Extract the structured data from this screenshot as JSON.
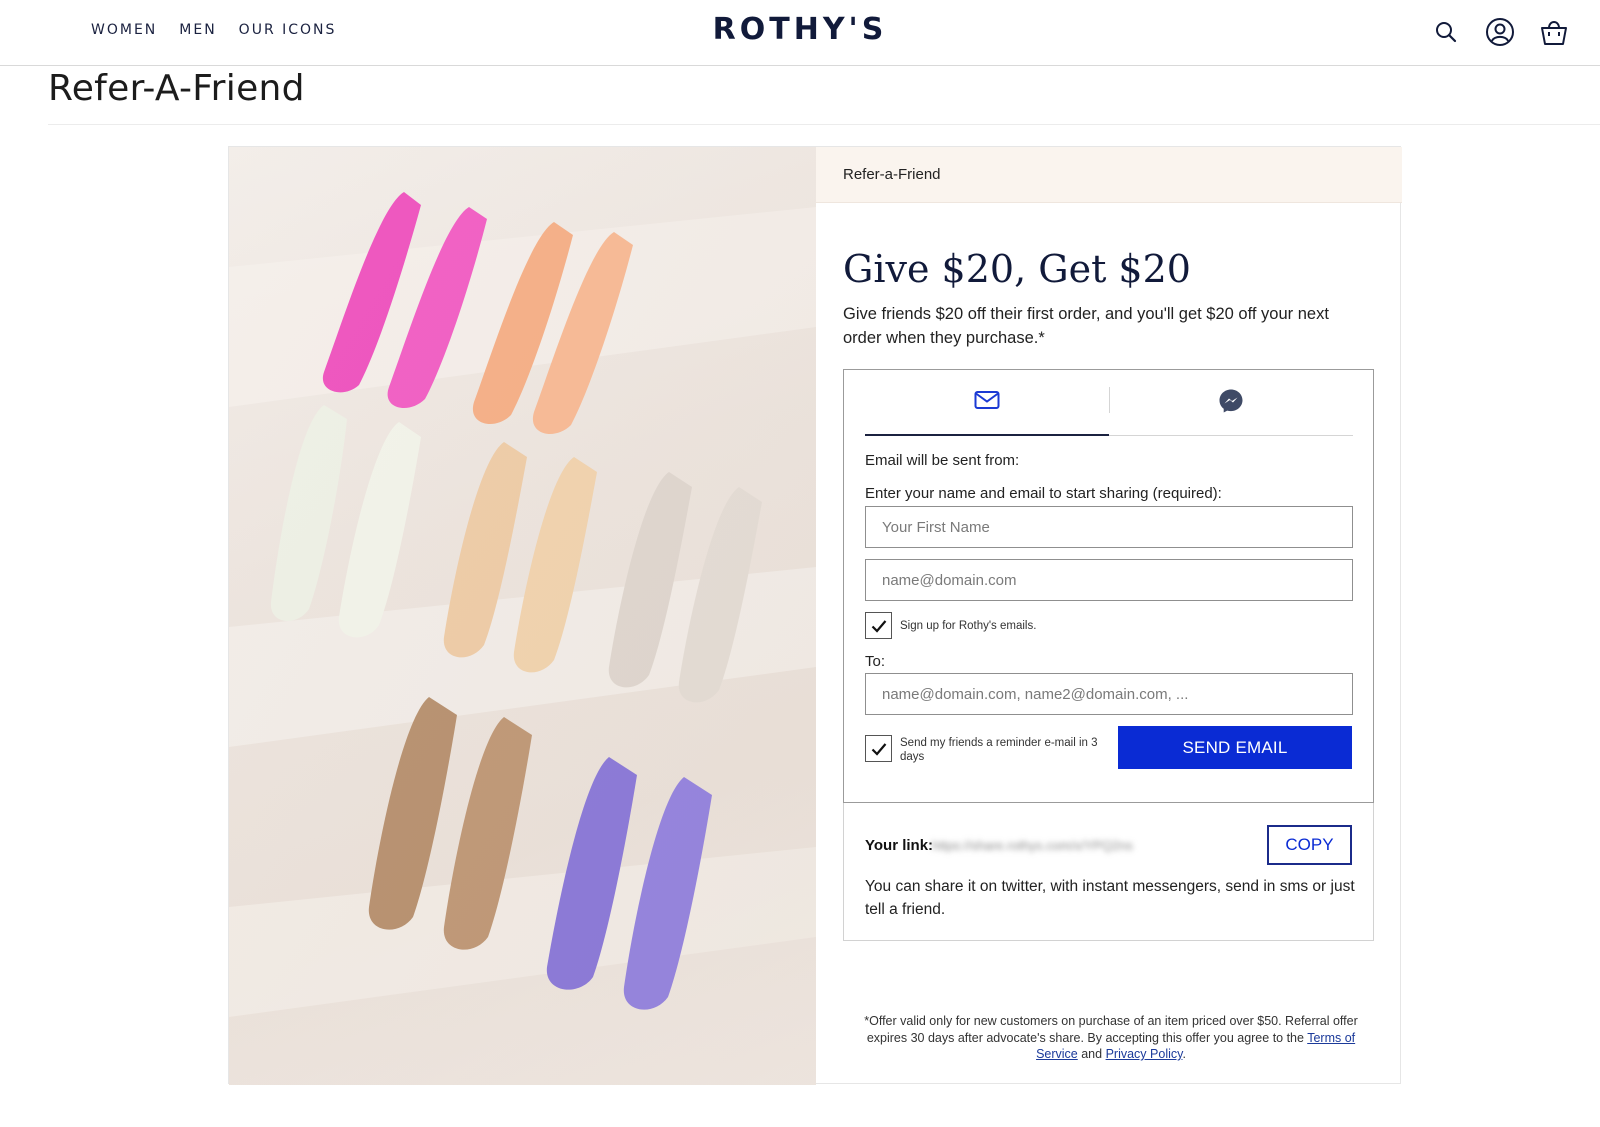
{
  "header": {
    "nav": [
      "WOMEN",
      "MEN",
      "OUR ICONS"
    ],
    "logo": "ROTHY'S",
    "icons": [
      "search-icon",
      "account-icon",
      "cart-icon"
    ]
  },
  "page": {
    "title": "Refer-A-Friend"
  },
  "panel": {
    "breadcrumb": "Refer-a-Friend",
    "headline": "Give $20, Get $20",
    "subline": "Give friends $20 off their first order, and you'll get $20 off your next order when they purchase.*",
    "tabs": [
      "email-icon",
      "messenger-icon"
    ],
    "from_label": "Email will be sent from:",
    "enter_label": "Enter your name and email to start sharing (required):",
    "first_name_placeholder": "Your First Name",
    "email_placeholder": "name@domain.com",
    "signup_label": "Sign up for Rothy's emails.",
    "signup_checked": true,
    "to_label": "To:",
    "to_placeholder": "name@domain.com, name2@domain.com, ...",
    "reminder_label": "Send my friends a reminder e-mail in 3 days",
    "reminder_checked": true,
    "send_button": "SEND EMAIL",
    "link_label": "Your link:",
    "link_url": "https://share.rothys.com/x/YPQ2ns",
    "copy_button": "COPY",
    "link_note": "You can share it on twitter, with instant messengers, send in sms or just tell a friend.",
    "fine_print_1": "*Offer valid only for new customers on purchase of an item priced over $50. Referral offer expires 30 days after advocate's share. By accepting this offer you agree to the",
    "terms_link": "Terms of Service",
    "fine_and": "and",
    "privacy_link": "Privacy Policy",
    "fine_end": "."
  },
  "colors": {
    "brand_navy": "#111a3a",
    "send_blue": "#0a2bd4",
    "head_beige": "#faf4ee"
  }
}
